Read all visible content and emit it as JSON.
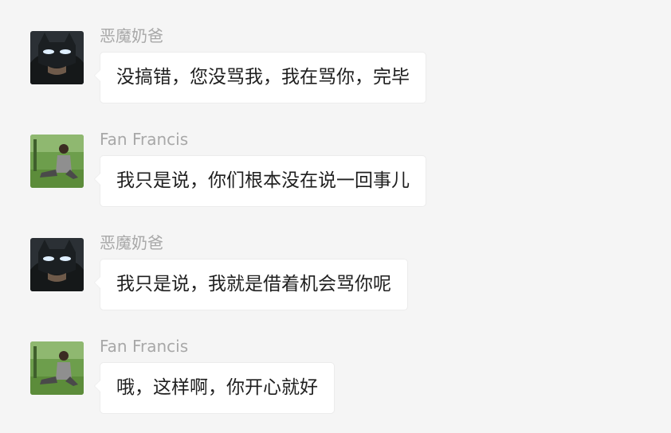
{
  "messages": [
    {
      "sender": "恶魔奶爸",
      "avatar_icon": "batman-mask-avatar-icon",
      "text": "没搞错，您没骂我，我在骂你，完毕"
    },
    {
      "sender": "Fan Francis",
      "avatar_icon": "person-on-grass-avatar-icon",
      "text": "我只是说，你们根本没在说一回事儿"
    },
    {
      "sender": "恶魔奶爸",
      "avatar_icon": "batman-mask-avatar-icon",
      "text": "我只是说，我就是借着机会骂你呢"
    },
    {
      "sender": "Fan Francis",
      "avatar_icon": "person-on-grass-avatar-icon",
      "text": "哦，这样啊，你开心就好"
    }
  ]
}
